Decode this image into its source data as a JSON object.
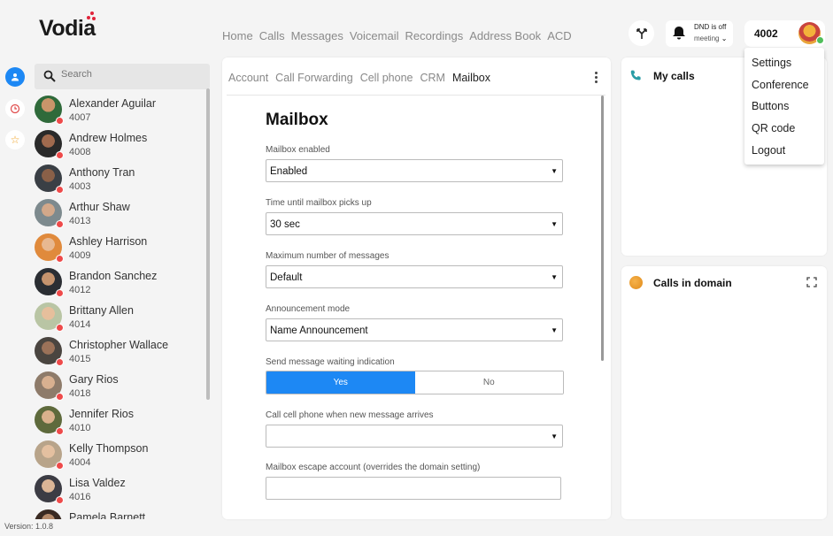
{
  "brand": {
    "name": "Vodia",
    "accent": "#e0243a"
  },
  "topnav": [
    "Home",
    "Calls",
    "Messages",
    "Voicemail",
    "Recordings",
    "Address Book",
    "ACD"
  ],
  "header": {
    "dnd_status": "DND is off",
    "dnd_mode": "meeting",
    "extension": "4002"
  },
  "user_menu": [
    "Settings",
    "Conference",
    "Buttons",
    "QR code",
    "Logout"
  ],
  "search": {
    "placeholder": "Search"
  },
  "contacts": [
    {
      "name": "Alexander Aguilar",
      "ext": "4007"
    },
    {
      "name": "Andrew Holmes",
      "ext": "4008"
    },
    {
      "name": "Anthony Tran",
      "ext": "4003"
    },
    {
      "name": "Arthur Shaw",
      "ext": "4013"
    },
    {
      "name": "Ashley Harrison",
      "ext": "4009"
    },
    {
      "name": "Brandon Sanchez",
      "ext": "4012"
    },
    {
      "name": "Brittany Allen",
      "ext": "4014"
    },
    {
      "name": "Christopher Wallace",
      "ext": "4015"
    },
    {
      "name": "Gary Rios",
      "ext": "4018"
    },
    {
      "name": "Jennifer Rios",
      "ext": "4010"
    },
    {
      "name": "Kelly Thompson",
      "ext": "4004"
    },
    {
      "name": "Lisa Valdez",
      "ext": "4016"
    },
    {
      "name": "Pamela Barnett",
      "ext": ""
    }
  ],
  "version": "Version: 1.0.8",
  "tabs": [
    "Account",
    "Call Forwarding",
    "Cell phone",
    "CRM",
    "Mailbox"
  ],
  "mailbox": {
    "title": "Mailbox",
    "enabled_label": "Mailbox enabled",
    "enabled_value": "Enabled",
    "pickup_label": "Time until mailbox picks up",
    "pickup_value": "30 sec",
    "max_label": "Maximum number of messages",
    "max_value": "Default",
    "announce_label": "Announcement mode",
    "announce_value": "Name Announcement",
    "mwi_label": "Send message waiting indication",
    "mwi_yes": "Yes",
    "mwi_no": "No",
    "mwi_selected": "Yes",
    "cell_label": "Call cell phone when new message arrives",
    "cell_value": "",
    "escape_label": "Mailbox escape account (overrides the domain setting)",
    "escape_value": ""
  },
  "panels": {
    "my_calls": "My calls",
    "calls_in_domain": "Calls in domain"
  }
}
